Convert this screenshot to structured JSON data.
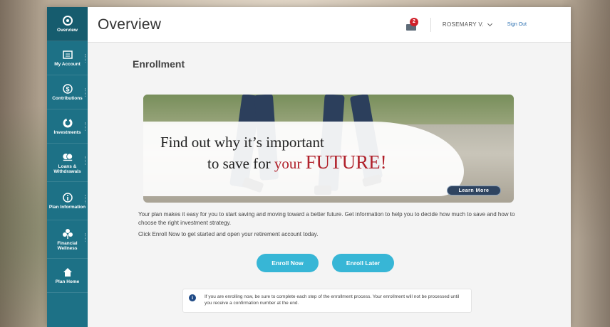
{
  "sidebar": {
    "items": [
      {
        "label": "Overview",
        "icon": "overview-icon"
      },
      {
        "label": "My Account",
        "icon": "account-icon"
      },
      {
        "label": "Contributions",
        "icon": "dollar-icon"
      },
      {
        "label": "Investments",
        "icon": "investments-icon"
      },
      {
        "label": "Loans & Withdrawals",
        "icon": "loans-icon"
      },
      {
        "label": "Plan Information",
        "icon": "info-icon"
      },
      {
        "label": "Financial Wellness",
        "icon": "wellness-icon"
      },
      {
        "label": "Plan Home",
        "icon": "home-icon"
      }
    ]
  },
  "header": {
    "title": "Overview",
    "mail_badge": "2",
    "user_name": "ROSEMARY V.",
    "sign_out": "Sign Out"
  },
  "content": {
    "section_title": "Enrollment",
    "banner": {
      "line1": "Find out why it’s important",
      "line2_prefix": "to save for ",
      "line2_red": "your ",
      "line2_big": "FUTURE!",
      "learn_more": "Learn More"
    },
    "description": "Your plan makes it easy for you to start saving and moving toward a better future. Get information to help you to decide how much to save and how to choose the right investment strategy.",
    "instruction": "Click Enroll Now to get started and open your retirement account today.",
    "enroll_now": "Enroll Now",
    "enroll_later": "Enroll Later",
    "info_note": "If you are enrolling now, be sure to complete each step of the enrollment process. Your enrollment will not be processed until you receive a confirmation number at the end."
  },
  "colors": {
    "sidebar": "#1d7186",
    "button": "#37b6d6",
    "accent_red": "#b0202a"
  }
}
